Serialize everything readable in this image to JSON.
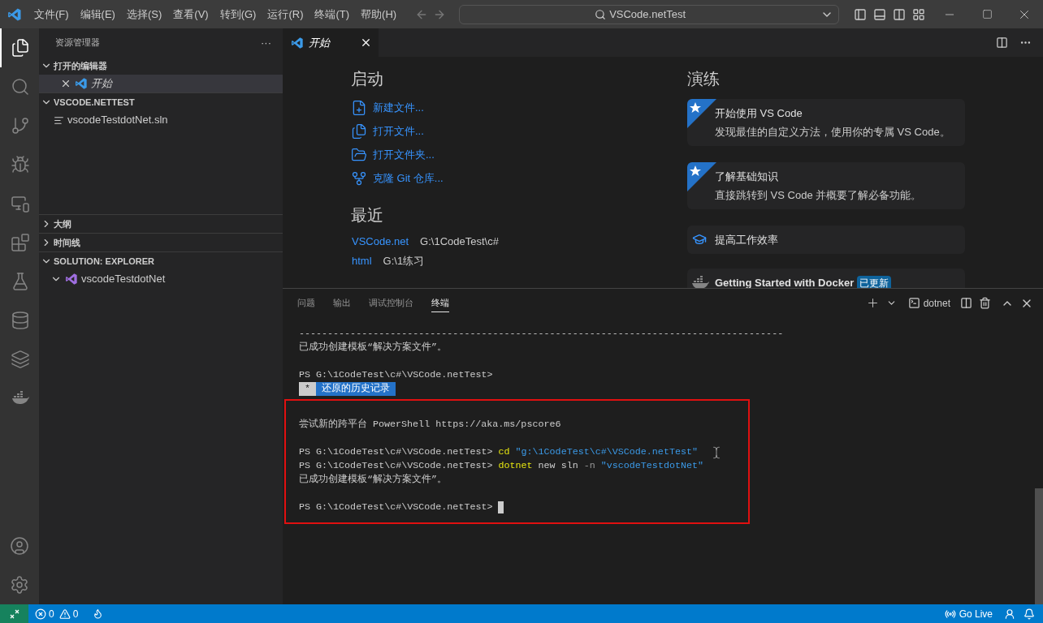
{
  "title_bar": {
    "menu": [
      "文件(F)",
      "编辑(E)",
      "选择(S)",
      "查看(V)",
      "转到(G)",
      "运行(R)",
      "终端(T)",
      "帮助(H)"
    ],
    "command_center": "VSCode.netTest"
  },
  "activity_bar": {
    "items": [
      {
        "kind": "files",
        "selected": true
      },
      {
        "kind": "search",
        "selected": false
      },
      {
        "kind": "source-control",
        "selected": false
      },
      {
        "kind": "run",
        "selected": false
      },
      {
        "kind": "remote",
        "selected": false
      },
      {
        "kind": "extensions",
        "selected": false
      },
      {
        "kind": "testing",
        "selected": false
      },
      {
        "kind": "database",
        "selected": false
      },
      {
        "kind": "layers",
        "selected": false
      },
      {
        "kind": "docker",
        "selected": false
      }
    ]
  },
  "sidebar": {
    "title": "资源管理器",
    "more": "···",
    "sections": [
      {
        "title": "打开的编辑器",
        "expanded": true,
        "items": [
          {
            "kind": "editor",
            "label": "开始",
            "selected": true
          }
        ]
      },
      {
        "title": "VSCODE.NETTEST",
        "expanded": true,
        "items": [
          {
            "kind": "file",
            "label": "vscodeTestdotNet.sln",
            "selected": false
          }
        ]
      },
      {
        "title": "大纲",
        "expanded": false
      },
      {
        "title": "时间线",
        "expanded": false
      },
      {
        "title": "SOLUTION: EXPLORER",
        "expanded": true,
        "items": [
          {
            "kind": "solution",
            "label": "vscodeTestdotNet",
            "selected": false
          }
        ]
      }
    ]
  },
  "editor": {
    "tabs": [
      {
        "label": "开始",
        "selected": true
      }
    ],
    "welcome": {
      "start_heading": "启动",
      "start_items": [
        {
          "kind": "new-file",
          "label": "新建文件..."
        },
        {
          "kind": "open-file",
          "label": "打开文件..."
        },
        {
          "kind": "open-folder",
          "label": "打开文件夹..."
        },
        {
          "kind": "clone",
          "label": "克隆 Git 仓库..."
        }
      ],
      "recent_heading": "最近",
      "recent": [
        {
          "name": "VSCode.net",
          "path": "G:\\1CodeTest\\c#"
        },
        {
          "name": "html",
          "path": "G:\\1练习"
        }
      ],
      "walkthroughs_heading": "演练",
      "walkthroughs": [
        {
          "kind": "featured",
          "title": "开始使用 VS Code",
          "description": "发现最佳的自定义方法，使用你的专属 VS Code。"
        },
        {
          "kind": "featured",
          "title": "了解基础知识",
          "description": "直接跳转到 VS Code 并概要了解必备功能。"
        },
        {
          "kind": "productivity",
          "title": "提高工作效率"
        },
        {
          "kind": "docker",
          "title": "Getting Started with Docker",
          "badge": "已更新"
        }
      ]
    }
  },
  "panel": {
    "tabs": [
      {
        "label": "问题",
        "selected": false
      },
      {
        "label": "输出",
        "selected": false
      },
      {
        "label": "调试控制台",
        "selected": false
      },
      {
        "label": "终端",
        "selected": true
      }
    ],
    "terminal_name": "dotnet",
    "blocks": [
      {
        "annotated": false,
        "lines": [
          {
            "kind": "text",
            "segments": [
              {
                "kind": "plain",
                "text": "-------------------------------------------------------------------------------------"
              }
            ]
          },
          {
            "kind": "text",
            "segments": [
              {
                "kind": "plain",
                "text": "已成功创建模板“解决方案文件”。"
              }
            ]
          },
          {
            "kind": "blank"
          },
          {
            "kind": "text",
            "segments": [
              {
                "kind": "plain",
                "text": "PS G:\\1CodeTest\\c#\\VSCode.netTest>"
              }
            ]
          },
          {
            "kind": "text",
            "segments": [
              {
                "kind": "marker",
                "text": " * "
              },
              {
                "kind": "banner",
                "text": " 还原的历史记录 "
              }
            ]
          }
        ]
      },
      {
        "annotated": true,
        "lines": [
          {
            "kind": "blank"
          },
          {
            "kind": "text",
            "segments": [
              {
                "kind": "plain",
                "text": "尝试新的跨平台 PowerShell https://aka.ms/pscore6"
              }
            ]
          },
          {
            "kind": "blank"
          },
          {
            "kind": "text",
            "segments": [
              {
                "kind": "plain",
                "text": "PS G:\\1CodeTest\\c#\\VSCode.netTest> "
              },
              {
                "kind": "command",
                "text": "cd"
              },
              {
                "kind": "string",
                "text": " \"g:\\1CodeTest\\c#\\VSCode.netTest\""
              }
            ]
          },
          {
            "kind": "text",
            "segments": [
              {
                "kind": "plain",
                "text": "PS G:\\1CodeTest\\c#\\VSCode.netTest> "
              },
              {
                "kind": "command",
                "text": "dotnet"
              },
              {
                "kind": "plain",
                "text": " new sln "
              },
              {
                "kind": "flag",
                "text": "-n"
              },
              {
                "kind": "string",
                "text": " \"vscodeTestdotNet\""
              }
            ]
          },
          {
            "kind": "text",
            "segments": [
              {
                "kind": "plain",
                "text": "已成功创建模板“解决方案文件”。"
              }
            ]
          },
          {
            "kind": "blank"
          },
          {
            "kind": "prompt",
            "segments": [
              {
                "kind": "plain",
                "text": "PS G:\\1CodeTest\\c#\\VSCode.netTest> "
              }
            ]
          }
        ]
      }
    ]
  },
  "status_bar": {
    "errors": "0",
    "warnings": "0",
    "go_live": "Go Live"
  }
}
